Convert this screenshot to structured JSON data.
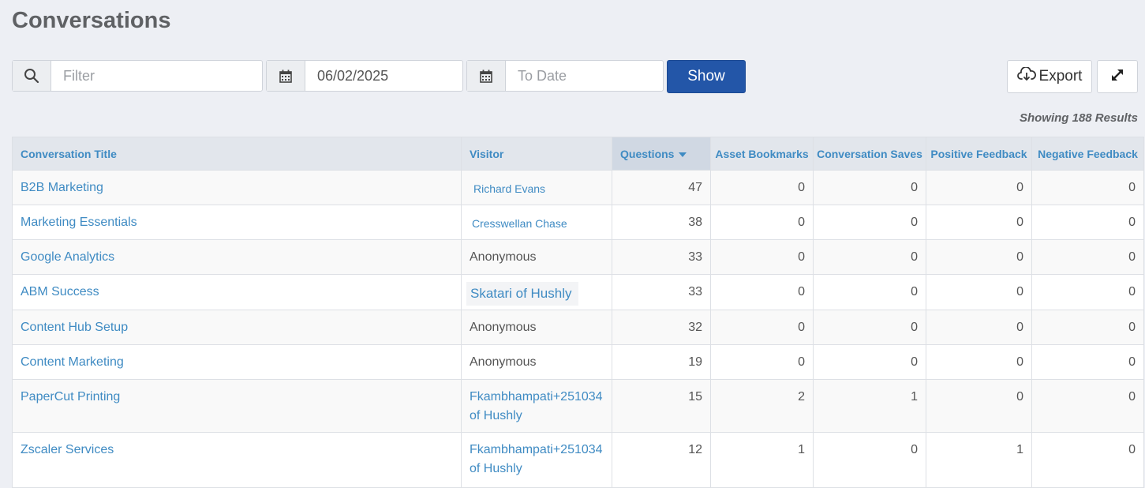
{
  "header": {
    "title": "Conversations"
  },
  "toolbar": {
    "filter_placeholder": "Filter",
    "from_date": "06/02/2025",
    "to_date_placeholder": "To Date",
    "show_label": "Show",
    "export_label": "Export"
  },
  "results_text": "Showing 188 Results",
  "table": {
    "columns": [
      "Conversation Title",
      "Visitor",
      "Questions",
      "Asset Bookmarks",
      "Conversation Saves",
      "Positive Feedback",
      "Negative Feedback"
    ],
    "sorted_column": "Questions",
    "rows": [
      {
        "title": "B2B Marketing",
        "visitor": "Richard Evans",
        "questions": "47",
        "bookmarks": "0",
        "saves": "0",
        "positive": "0",
        "negative": "0"
      },
      {
        "title": "Marketing Essentials",
        "visitor": "Cresswellan Chase",
        "questions": "38",
        "bookmarks": "0",
        "saves": "0",
        "positive": "0",
        "negative": "0"
      },
      {
        "title": "Google Analytics",
        "visitor": "Anonymous",
        "questions": "33",
        "bookmarks": "0",
        "saves": "0",
        "positive": "0",
        "negative": "0"
      },
      {
        "title": "ABM Success",
        "visitor": "Skatari of Hushly",
        "questions": "33",
        "bookmarks": "0",
        "saves": "0",
        "positive": "0",
        "negative": "0"
      },
      {
        "title": "Content Hub Setup",
        "visitor": "Anonymous",
        "questions": "32",
        "bookmarks": "0",
        "saves": "0",
        "positive": "0",
        "negative": "0"
      },
      {
        "title": "Content Marketing",
        "visitor": "Anonymous",
        "questions": "19",
        "bookmarks": "0",
        "saves": "0",
        "positive": "0",
        "negative": "0"
      },
      {
        "title": "PaperCut Printing",
        "visitor_line1": "Fkambhampati+251034",
        "visitor_line2": "of Hushly",
        "questions": "15",
        "bookmarks": "2",
        "saves": "1",
        "positive": "0",
        "negative": "0"
      },
      {
        "title": "Zscaler Services",
        "visitor_line1": "Fkambhampati+251034",
        "visitor_line2": "of Hushly",
        "questions": "12",
        "bookmarks": "1",
        "saves": "0",
        "positive": "1",
        "negative": "0"
      }
    ]
  },
  "icons": [
    "search-icon",
    "calendar-icon",
    "cloud-download-icon",
    "expand-icon"
  ]
}
